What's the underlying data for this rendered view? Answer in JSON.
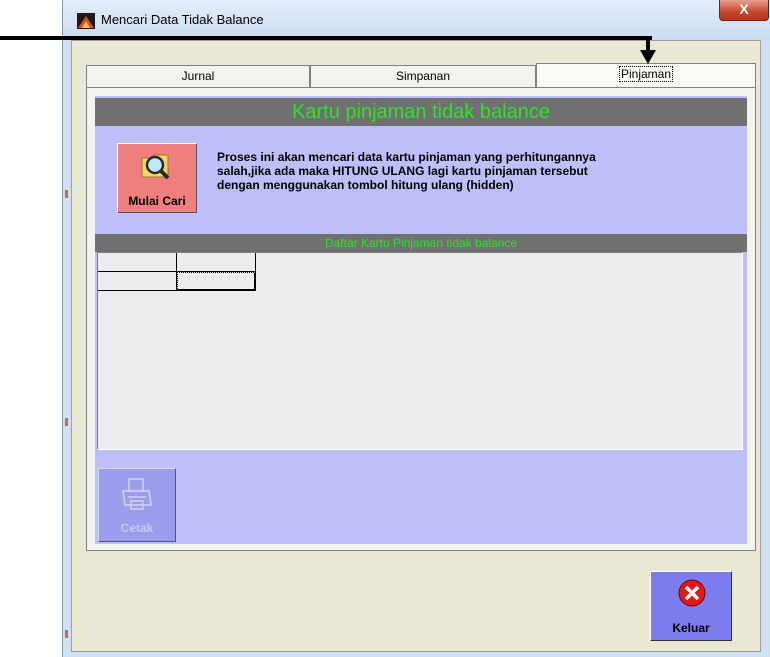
{
  "window": {
    "title": "Mencari Data Tidak Balance",
    "close_symbol": "X"
  },
  "tabs": [
    {
      "label": "Jurnal"
    },
    {
      "label": "Simpanan"
    },
    {
      "label": "Pinjaman",
      "active": true
    }
  ],
  "panel": {
    "banner_title": "Kartu pinjaman tidak balance",
    "search_button_label": "Mulai Cari",
    "search_icon": "magnifier-folder-icon",
    "description_lines": [
      "Proses ini akan mencari data kartu pinjaman  yang perhitungannya",
      "salah,jika ada maka HITUNG ULANG lagi kartu pinjaman tersebut",
      "dengan menggunakan tombol hitung ulang (hidden)"
    ],
    "grid_title": "Daftar Kartu Pinjaman tidak balance",
    "print_button_label": "Cetak",
    "print_icon": "printer-icon"
  },
  "footer": {
    "exit_button_label": "Keluar",
    "exit_icon": "close-circle-icon"
  },
  "colors": {
    "banner_text": "#2ee02e",
    "banner_bg": "#707070",
    "panel_bg": "#bebef8",
    "search_button_bg": "#f08080",
    "exit_button_bg": "#7c7cee"
  }
}
